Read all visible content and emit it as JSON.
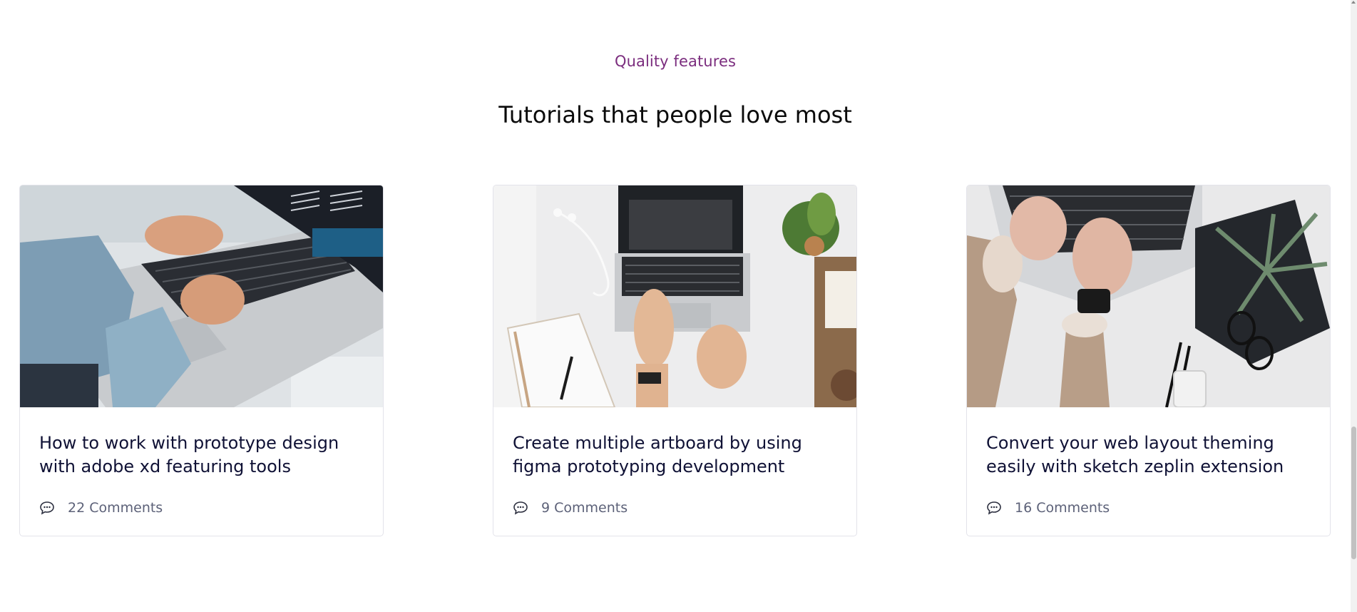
{
  "section": {
    "eyebrow": "Quality features",
    "title": "Tutorials that people love most"
  },
  "cards": [
    {
      "title": "How to work with prototype design with adobe xd featuring tools",
      "comments": "22 Comments",
      "icon": "comment-icon",
      "image": "photo of hands typing on a laptop"
    },
    {
      "title": "Create multiple artboard by using figma prototyping development",
      "comments": "9 Comments",
      "icon": "comment-icon",
      "image": "top-down photo of laptop with notebook and plant"
    },
    {
      "title": "Convert your web layout theming easily with sketch zeplin extension",
      "comments": "16 Comments",
      "icon": "comment-icon",
      "image": "top-down photo of hands on laptop with plant and glasses"
    }
  ],
  "colors": {
    "eyebrow": "#7b2d7e",
    "title": "#0a0a0a",
    "card_title": "#0f1135",
    "meta": "#5c6178",
    "card_border": "#e3e3ea"
  }
}
